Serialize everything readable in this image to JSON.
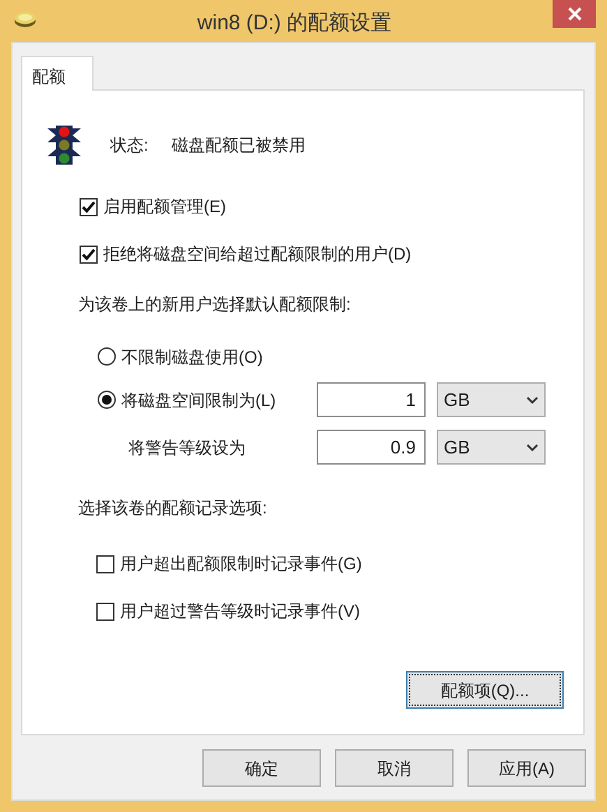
{
  "window": {
    "title": "win8 (D:) 的配额设置"
  },
  "tabs": [
    {
      "label": "配额",
      "selected": true
    }
  ],
  "status": {
    "label": "状态:",
    "value": "磁盘配额已被禁用"
  },
  "options": [
    {
      "label": "启用配额管理(E)",
      "checked": true
    },
    {
      "label": "拒绝将磁盘空间给超过配额限制的用户(D)",
      "checked": true
    }
  ],
  "default_limit": {
    "heading": "为该卷上的新用户选择默认配额限制:",
    "choices": [
      {
        "label": "不限制磁盘使用(O)",
        "selected": false
      },
      {
        "label": "将磁盘空间限制为(L)",
        "selected": true,
        "value": "1",
        "unit": "GB"
      }
    ],
    "warning": {
      "label": "将警告等级设为",
      "value": "0.9",
      "unit": "GB"
    }
  },
  "logging": {
    "heading": "选择该卷的配额记录选项:",
    "options": [
      {
        "label": "用户超出配额限制时记录事件(G)",
        "checked": false
      },
      {
        "label": "用户超过警告等级时记录事件(V)",
        "checked": false
      }
    ]
  },
  "quota_entries_button": "配额项(Q)...",
  "buttons": [
    "确定",
    "取消",
    "应用(A)"
  ]
}
